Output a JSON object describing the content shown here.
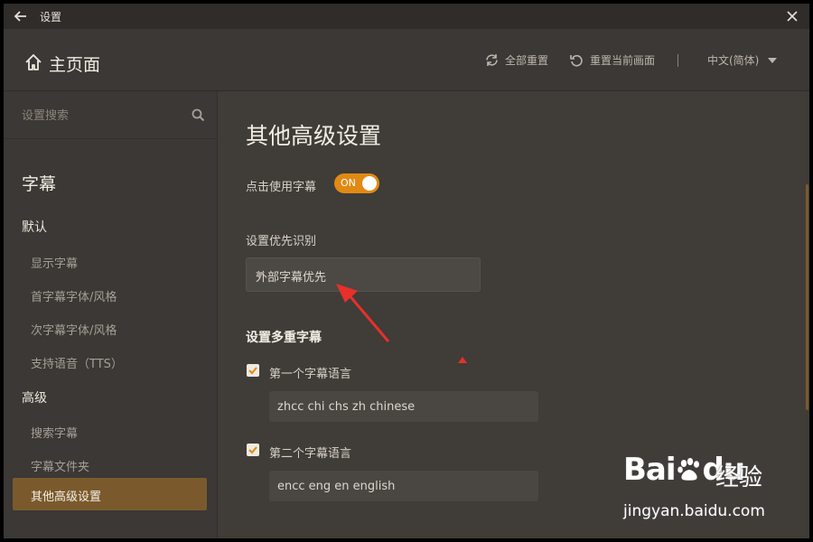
{
  "window": {
    "title": "设置"
  },
  "header": {
    "home_title": "主页面",
    "reset_all_label": "全部重置",
    "reset_current_label": "重置当前画面",
    "language_label": "中文(简体)"
  },
  "sidebar": {
    "search_placeholder": "设置搜索",
    "heading": "字幕",
    "group_default": "默认",
    "items_default": [
      "显示字幕",
      "首字幕字体/风格",
      "次字幕字体/风格",
      "支持语音（TTS）"
    ],
    "group_advanced": "高级",
    "items_advanced": [
      "搜索字幕",
      "字幕文件夹",
      "其他高级设置"
    ],
    "active_item": "其他高级设置"
  },
  "main": {
    "page_title": "其他高级设置",
    "click_use_subtitle_label": "点击使用字幕",
    "toggle_state": "ON",
    "priority_label": "设置优先识别",
    "priority_selected": "外部字幕优先",
    "multi_subtitle_title": "设置多重字幕",
    "first_language_label": "第一个字幕语言",
    "first_language_value": "zhcc chi chs zh chinese",
    "second_language_label": "第二个字幕语言",
    "second_language_value": "encc eng en english"
  },
  "watermark": {
    "logo": "Bai",
    "logo_suffix": "du",
    "brand_cn": "经验",
    "url": "jingyan.baidu.com"
  },
  "colors": {
    "accent": "#e08a14",
    "active_item_bg": "#7a5a2c",
    "annotation": "#e8302a"
  }
}
